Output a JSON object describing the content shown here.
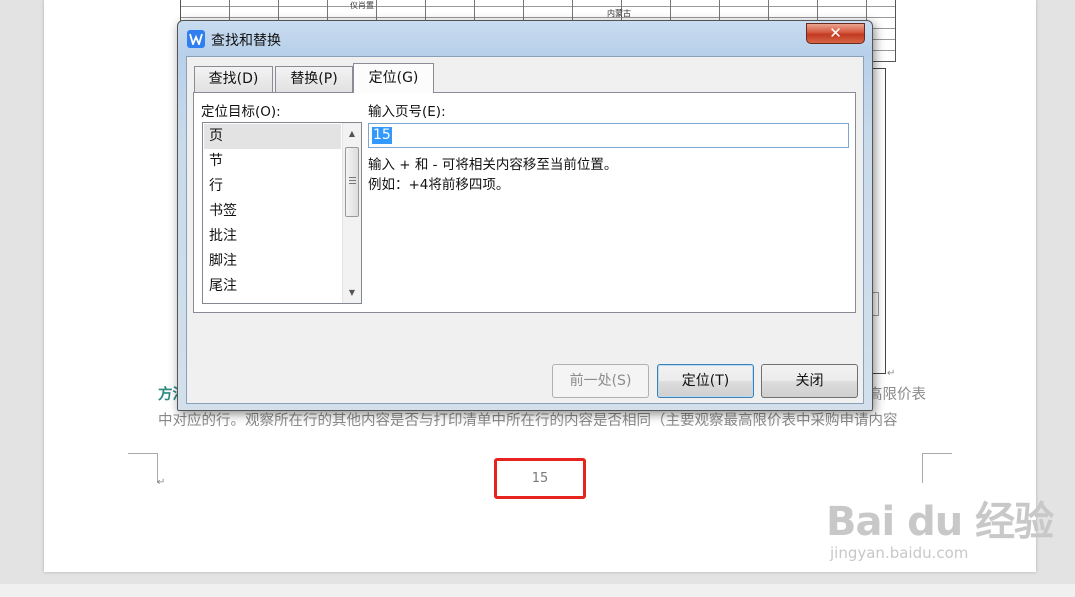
{
  "document": {
    "table_labels": [
      "仪肖置",
      "内蒙古"
    ],
    "body_line1_prefix": "方法",
    "body_line1_suffix": "高限价表",
    "body_line2": "中对应的行。观察所在行的其他内容是否与打印清单中所在行的内容是否相同（主要观察最高限价表中采购申请内容",
    "para_mark": "↵",
    "page_number": "15"
  },
  "watermark": {
    "logo": "Bai du 经验",
    "url": "jingyan.baidu.com"
  },
  "dialog": {
    "title": "查找和替换",
    "close_symbol": "✕",
    "tabs": [
      {
        "label": "查找(D)",
        "active": false
      },
      {
        "label": "替换(P)",
        "active": false
      },
      {
        "label": "定位(G)",
        "active": true
      }
    ],
    "target_label": "定位目标(O):",
    "targets": [
      "页",
      "节",
      "行",
      "书签",
      "批注",
      "脚注",
      "尾注"
    ],
    "selected_target": "页",
    "page_input_label": "输入页号(E):",
    "page_input_value": "15",
    "hint_line1": "输入 + 和 - 可将相关内容移至当前位置。",
    "hint_line2": "例如：+4将前移四项。",
    "buttons": {
      "previous": "前一处(S)",
      "goto": "定位(T)",
      "close": "关闭"
    }
  },
  "colors": {
    "highlight_box": "#e5231f",
    "selection": "#3399ff",
    "close_button": "#c94a30"
  }
}
